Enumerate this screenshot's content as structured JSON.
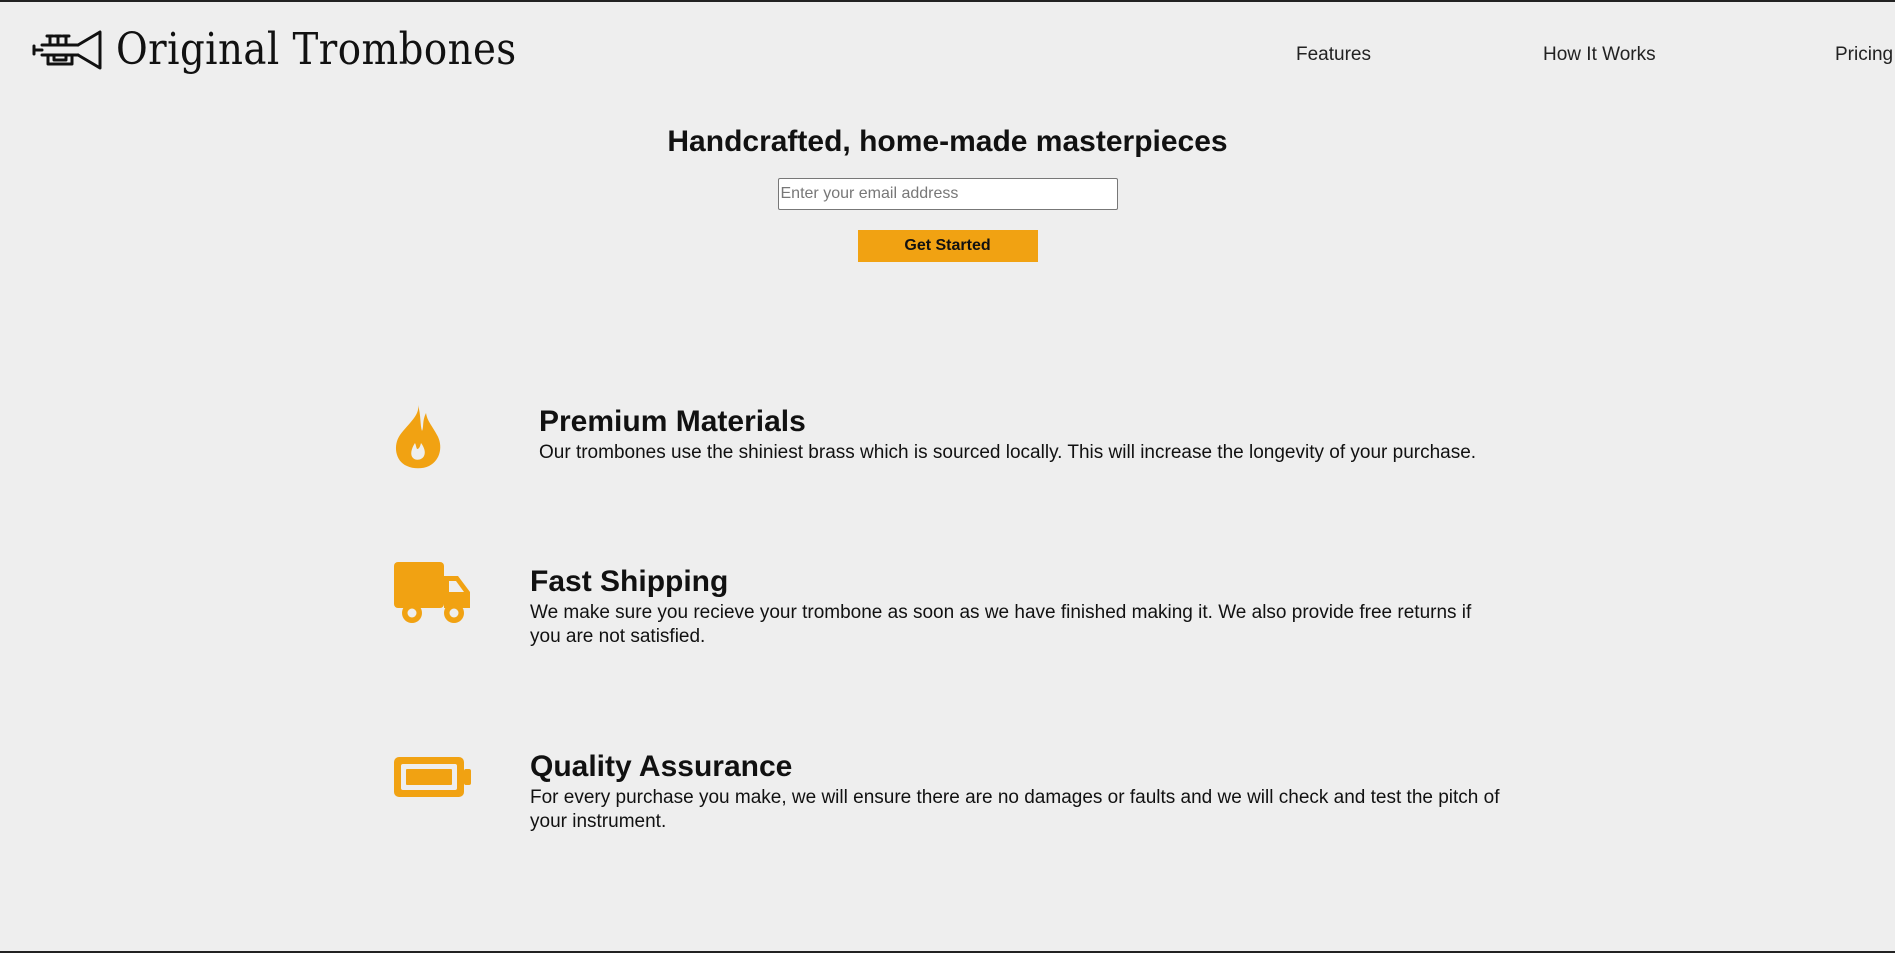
{
  "header": {
    "logo_icon": "trumpet-icon",
    "brand_name": "Original Trombones",
    "nav": [
      {
        "label": "Features"
      },
      {
        "label": "How It Works"
      },
      {
        "label": "Pricing"
      }
    ]
  },
  "hero": {
    "title": "Handcrafted, home-made masterpieces",
    "email_placeholder": "Enter your email address",
    "button_label": "Get Started"
  },
  "features": [
    {
      "icon": "fire-icon",
      "title": "Premium Materials",
      "description": "Our trombones use the shiniest brass which is sourced locally. This will increase the longevity of your purchase."
    },
    {
      "icon": "truck-icon",
      "title": "Fast Shipping",
      "description": "We make sure you recieve your trombone as soon as we have finished making it. We also provide free returns if you are not satisfied."
    },
    {
      "icon": "battery-icon",
      "title": "Quality Assurance",
      "description": "For every purchase you make, we will ensure there are no damages or faults and we will check and test the pitch of your instrument."
    }
  ],
  "colors": {
    "accent": "#f1a212",
    "background": "#eeeeee",
    "text": "#111111"
  }
}
